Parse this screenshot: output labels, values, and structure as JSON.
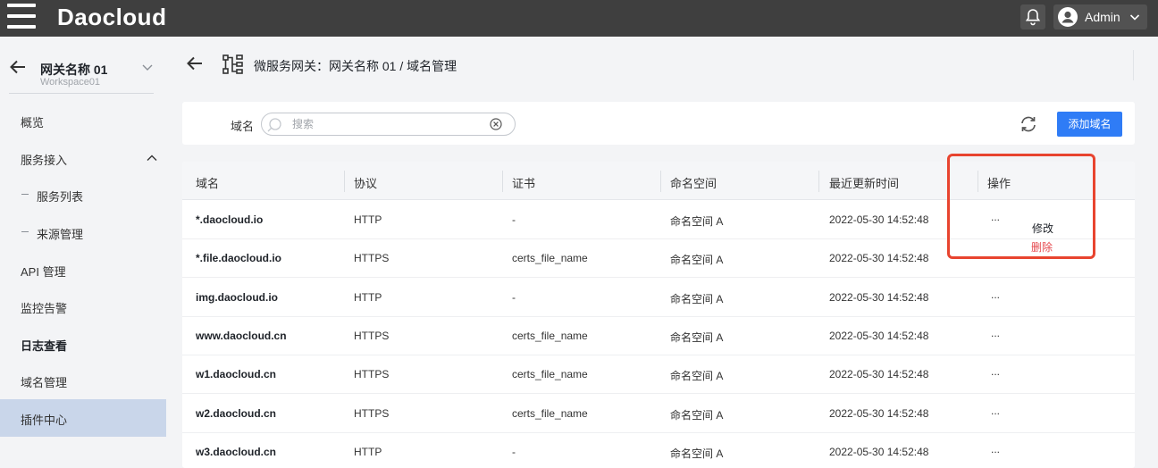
{
  "app": {
    "brand": "Daocloud"
  },
  "user": {
    "name": "Admin"
  },
  "workspace": {
    "name": "网关名称 01",
    "sub": "Workspace01"
  },
  "sidebar": {
    "items": [
      {
        "label": "概览"
      },
      {
        "label": "服务接入"
      },
      {
        "label": "服务列表"
      },
      {
        "label": "来源管理"
      },
      {
        "label": "API 管理"
      },
      {
        "label": "监控告警"
      },
      {
        "label": "日志查看"
      },
      {
        "label": "域名管理"
      },
      {
        "label": "插件中心"
      }
    ]
  },
  "breadcrumb": "微服务网关：网关名称 01 / 域名管理",
  "filter": {
    "label": "域名",
    "placeholder": "搜索",
    "add_label": "添加域名"
  },
  "table": {
    "headers": [
      "域名",
      "协议",
      "证书",
      "命名空间",
      "最近更新时间",
      "操作"
    ],
    "rows": [
      [
        "*.daocloud.io",
        "HTTP",
        "-",
        "命名空间 A",
        "2022-05-30 14:52:48",
        "..."
      ],
      [
        "*.file.daocloud.io",
        "HTTPS",
        "certs_file_name",
        "命名空间 A",
        "2022-05-30 14:52:48",
        "..."
      ],
      [
        "img.daocloud.io",
        "HTTP",
        "-",
        "命名空间 A",
        "2022-05-30 14:52:48",
        "..."
      ],
      [
        "www.daocloud.cn",
        "HTTPS",
        "certs_file_name",
        "命名空间 A",
        "2022-05-30 14:52:48",
        "..."
      ],
      [
        "w1.daocloud.cn",
        "HTTPS",
        "certs_file_name",
        "命名空间 A",
        "2022-05-30 14:52:48",
        "..."
      ],
      [
        "w2.daocloud.cn",
        "HTTPS",
        "certs_file_name",
        "命名空间 A",
        "2022-05-30 14:52:48",
        "..."
      ],
      [
        "w3.daocloud.cn",
        "HTTP",
        "-",
        "命名空间 A",
        "2022-05-30 14:52:48",
        "..."
      ]
    ]
  },
  "action_menu": {
    "edit": "修改",
    "delete": "删除"
  },
  "colors": {
    "topbar": "#3f3f3f",
    "primary": "#2f7cf6",
    "danger": "#e5484d",
    "highlight": "#e8442f",
    "active_nav": "#c9d6ea"
  },
  "icons": [
    "menu-icon",
    "bell-icon",
    "user-avatar-icon",
    "chevron-down-icon",
    "back-arrow-icon",
    "tree-icon",
    "search-icon",
    "clear-icon",
    "refresh-icon",
    "chevron-up-icon"
  ]
}
